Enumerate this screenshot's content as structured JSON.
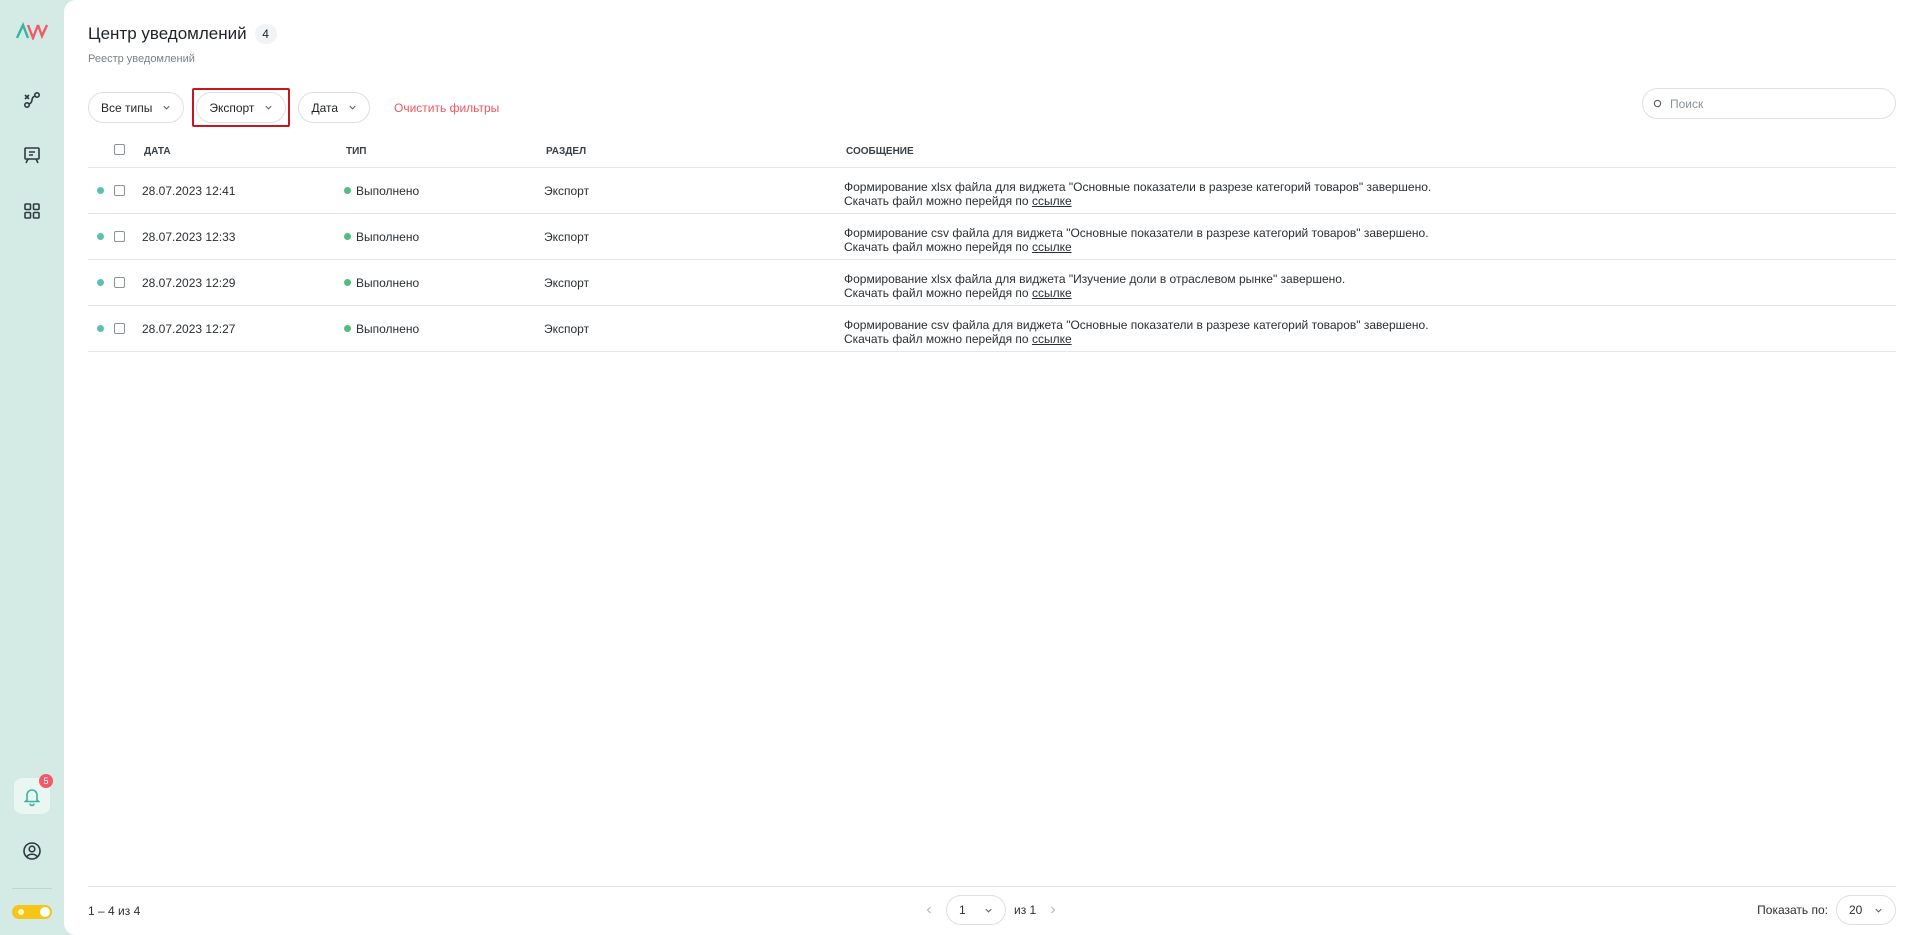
{
  "header": {
    "title": "Центр уведомлений",
    "count": "4",
    "subtitle": "Реестр уведомлений"
  },
  "filters": {
    "types": "Все типы",
    "section": "Экспорт",
    "date": "Дата",
    "clear": "Очистить фильтры"
  },
  "search": {
    "placeholder": "Поиск"
  },
  "table": {
    "columns": {
      "date": "Дата",
      "type": "Тип",
      "section": "Раздел",
      "message": "Сообщение"
    },
    "rows": [
      {
        "date": "28.07.2023 12:41",
        "status": "Выполнено",
        "section": "Экспорт",
        "message_line1": "Формирование xlsx файла для виджета \"Основные показатели в разрезе категорий товаров\" завершено.",
        "message_line2": "Скачать файл можно перейдя по ",
        "link": "ссылке"
      },
      {
        "date": "28.07.2023 12:33",
        "status": "Выполнено",
        "section": "Экспорт",
        "message_line1": "Формирование csv файла для виджета \"Основные показатели в разрезе категорий товаров\" завершено.",
        "message_line2": "Скачать файл можно перейдя по ",
        "link": "ссылке"
      },
      {
        "date": "28.07.2023 12:29",
        "status": "Выполнено",
        "section": "Экспорт",
        "message_line1": "Формирование xlsx файла для виджета \"Изучение доли в отраслевом рынке\" завершено.",
        "message_line2": "Скачать файл можно перейдя по ",
        "link": "ссылке"
      },
      {
        "date": "28.07.2023 12:27",
        "status": "Выполнено",
        "section": "Экспорт",
        "message_line1": "Формирование csv файла для виджета \"Основные показатели в разрезе категорий товаров\" завершено.",
        "message_line2": "Скачать файл можно перейдя по ",
        "link": "ссылке"
      }
    ]
  },
  "sidebar": {
    "notifications_badge": "5"
  },
  "footer": {
    "range": "1 – 4 из 4",
    "page": "1",
    "of_pages": "из 1",
    "per_page_label": "Показать по:",
    "per_page": "20"
  },
  "colors": {
    "sidebar_bg": "#d3ebe4",
    "accent_red": "#f0555f",
    "status_green": "#4cc07a",
    "unread_teal": "#5bc0b3",
    "highlight_box": "#c8161d"
  }
}
